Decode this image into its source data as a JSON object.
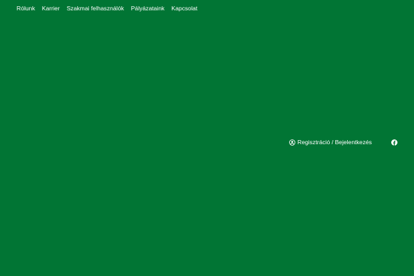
{
  "nav": {
    "items": [
      {
        "label": "Rólunk"
      },
      {
        "label": "Karrier"
      },
      {
        "label": "Szakmai felhasználók"
      },
      {
        "label": "Pályázataink"
      },
      {
        "label": "Kapcsolat"
      }
    ]
  },
  "account": {
    "label": "Regisztráció / Bejelentkezés",
    "icon": "user-circle-icon"
  },
  "social": {
    "icon": "facebook-icon"
  },
  "colors": {
    "background": "#017534",
    "text": "#ffffff"
  }
}
